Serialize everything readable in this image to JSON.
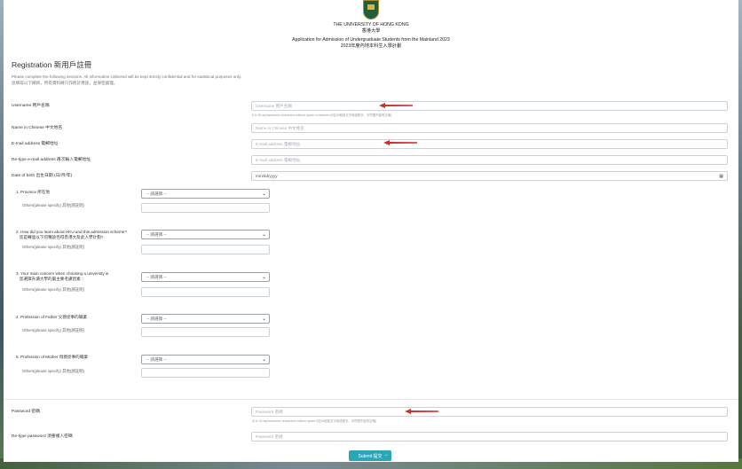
{
  "header": {
    "university_en": "THE UNIVERSITY OF HONG KONG",
    "university_zh": "香港大學",
    "application_en": "Application for Admission of Undergraduate Students from the Mainland 2023",
    "application_zh": "2023年度內地本科生入學計劃"
  },
  "form": {
    "title": "Registration 新用戶註冊",
    "intro_en": "Please complete the following sections. All information collected will be kept strictly confidential and for statistical purposes only.",
    "intro_zh": "您填寫以下欄目，所有資料將只作統計用途，並保密處理。",
    "username_label": "Username 用戶名稱",
    "username_placeholder": "Username 用戶名稱",
    "username_hint": "8 to 30 alphanumeric characters without space in between (8至30個英文字母或數字，字符間不能有空格)",
    "name_zh_label": "Name in Chinese 中文姓名",
    "name_zh_placeholder": "Name in Chinese 中文姓名",
    "email_label": "E-mail address 電郵地址",
    "email_placeholder": "E-mail address 電郵地址",
    "email2_label": "Re-type e-mail address 再次輸入電郵地址",
    "email2_placeholder": "E-mail address 電郵地址",
    "dob_label": "Date of birth 出生日期 (日/月/年)",
    "dob_placeholder": "mm/dd/yyyy",
    "select_default": "-- 請選擇 --",
    "other_label": "Others(please specify) 其他(請註明)",
    "questions": [
      {
        "num": "1.",
        "text": "Province 所在地"
      },
      {
        "num": "2.",
        "text": "How did you learn about HKU and this admission scheme?",
        "text_zh": "您是轉過以下何種途徑得悉港大及此入學計劃?"
      },
      {
        "num": "3.",
        "text": "Your main concern when choosing a university is",
        "text_zh": "您選擇升讀大學的最主要考慮因素 ："
      },
      {
        "num": "4.",
        "text": "Profession of Father 父親從事的職業"
      },
      {
        "num": "5.",
        "text": "Profession of Mother 母親從事的職業"
      }
    ],
    "password_label": "Password 密碼",
    "password_placeholder": "Password 密碼",
    "password_hint": "(8 to 30 alphanumeric characters without space 8至30個英文字母或數字，字符間不能有空格)",
    "password2_label": "Re-type password 須重複入密碼",
    "password2_placeholder": "Password 密碼",
    "submit_label": "Submit 提交",
    "submit_arrow": "→"
  },
  "colors": {
    "accent": "#2aa6b8",
    "arrow": "#d22c2c"
  }
}
